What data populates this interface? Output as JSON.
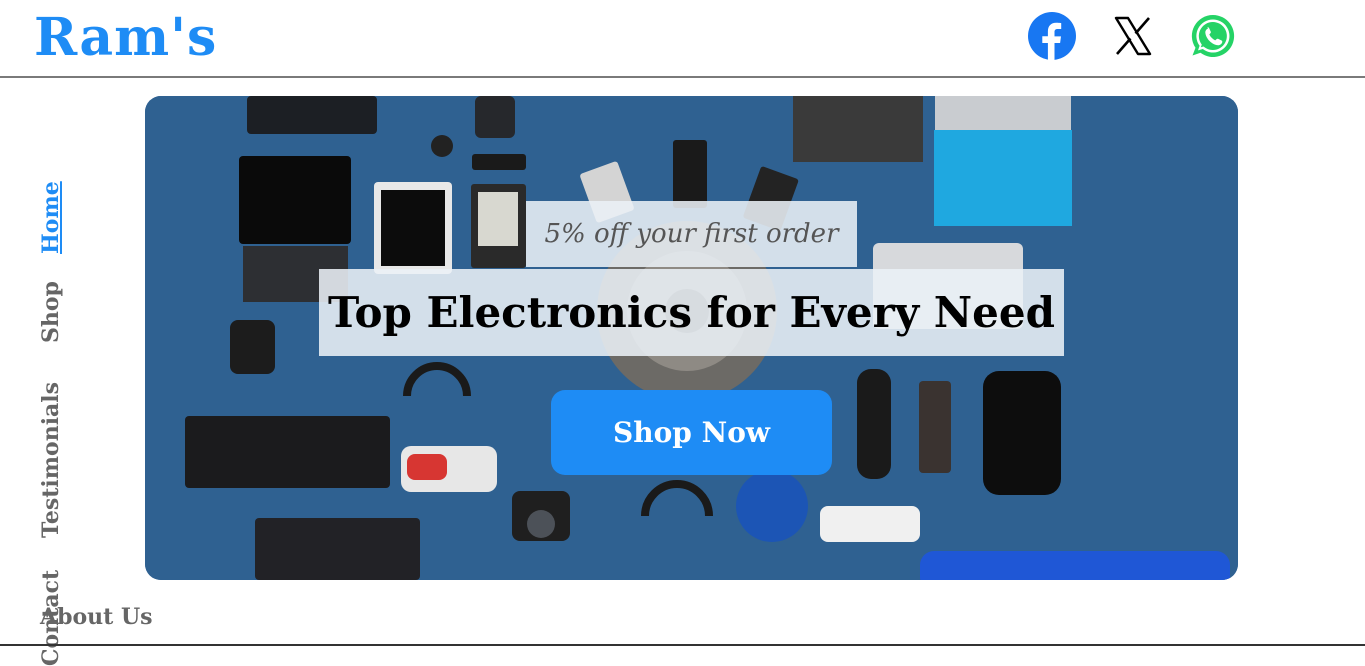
{
  "brand": {
    "name": "Ram's",
    "color": "#1e8cf5"
  },
  "social": [
    {
      "name": "facebook-icon",
      "color": "#1877f2"
    },
    {
      "name": "x-icon",
      "color": "#000000"
    },
    {
      "name": "whatsapp-icon",
      "color": "#25d366"
    }
  ],
  "nav": {
    "items": [
      {
        "label": "Home",
        "active": true
      },
      {
        "label": "Shop",
        "active": false
      },
      {
        "label": "Testimonials",
        "active": false
      },
      {
        "label": "Contact",
        "active": false
      }
    ],
    "about_label": "About Us"
  },
  "hero": {
    "promo": "5% off your first order",
    "headline": "Top Electronics for Every Need",
    "cta_label": "Shop Now",
    "background_color": "#2f6191",
    "cta_color": "#1e8cf5"
  }
}
